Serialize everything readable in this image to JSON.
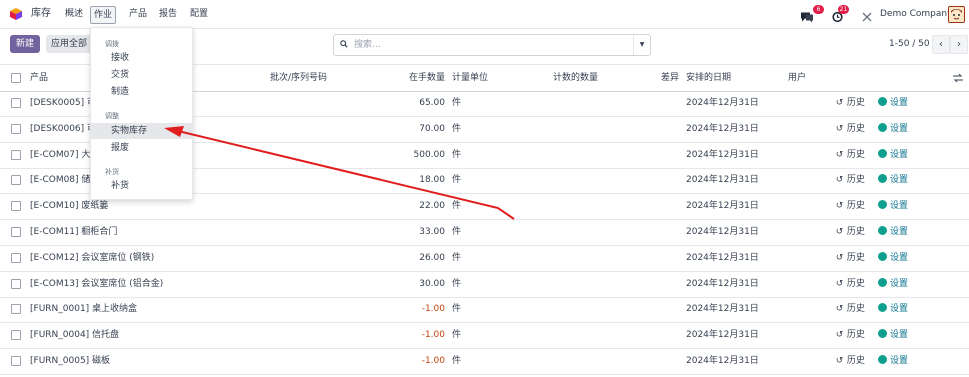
{
  "nav": {
    "app": "库存",
    "items": [
      "概述",
      "作业",
      "产品",
      "报告",
      "配置"
    ],
    "active": "作业"
  },
  "topright": {
    "chat_count": "6",
    "activity_count": "21",
    "company": "Demo Company"
  },
  "controls": {
    "new_label": "新建",
    "apply_label": "应用全部",
    "search_placeholder": "搜索...",
    "pager": "1-50 / 50"
  },
  "dropdown": {
    "sections": [
      {
        "title": "调拨",
        "items": [
          "接收",
          "交货",
          "制造"
        ]
      },
      {
        "title": "调整",
        "items": [
          "实物库存",
          "报废"
        ]
      },
      {
        "title": "补货",
        "items": [
          "补货"
        ]
      }
    ],
    "highlighted": "实物库存"
  },
  "table": {
    "headers": {
      "product": "产品",
      "lot": "批次/序列号码",
      "qty": "在手数量",
      "uom": "计量单位",
      "counted": "计数的数量",
      "diff": "差异",
      "date": "安排的日期",
      "user": "用户"
    },
    "history_label": "历史",
    "settings_label": "设置",
    "rows": [
      {
        "product": "[DESK0005] 可定",
        "qty": "65.00",
        "uom": "件",
        "date": "2024年12月31日",
        "neg": false
      },
      {
        "product": "[DESK0006] 可定",
        "qty": "70.00",
        "uom": "件",
        "date": "2024年12月31日",
        "neg": false
      },
      {
        "product": "[E-COM07] 大柜",
        "qty": "500.00",
        "uom": "件",
        "date": "2024年12月31日",
        "neg": false
      },
      {
        "product": "[E-COM08] 储存",
        "qty": "18.00",
        "uom": "件",
        "date": "2024年12月31日",
        "neg": false
      },
      {
        "product": "[E-COM10] 废纸篓",
        "qty": "22.00",
        "uom": "件",
        "date": "2024年12月31日",
        "neg": false
      },
      {
        "product": "[E-COM11] 橱柜合门",
        "qty": "33.00",
        "uom": "件",
        "date": "2024年12月31日",
        "neg": false
      },
      {
        "product": "[E-COM12] 会议室席位 (钢铁)",
        "qty": "26.00",
        "uom": "件",
        "date": "2024年12月31日",
        "neg": false
      },
      {
        "product": "[E-COM13] 会议室席位 (铝合金)",
        "qty": "30.00",
        "uom": "件",
        "date": "2024年12月31日",
        "neg": false
      },
      {
        "product": "[FURN_0001] 桌上收纳盒",
        "qty": "-1.00",
        "uom": "件",
        "date": "2024年12月31日",
        "neg": true
      },
      {
        "product": "[FURN_0004] 信托盘",
        "qty": "-1.00",
        "uom": "件",
        "date": "2024年12月31日",
        "neg": true
      },
      {
        "product": "[FURN_0005] 磁板",
        "qty": "-1.00",
        "uom": "件",
        "date": "2024年12月31日",
        "neg": true
      }
    ]
  },
  "colors": {
    "brand": "#71639e",
    "settings": "#0e9f8e",
    "negative": "#c2410c",
    "annotation_arrow": "#e11d1d"
  }
}
